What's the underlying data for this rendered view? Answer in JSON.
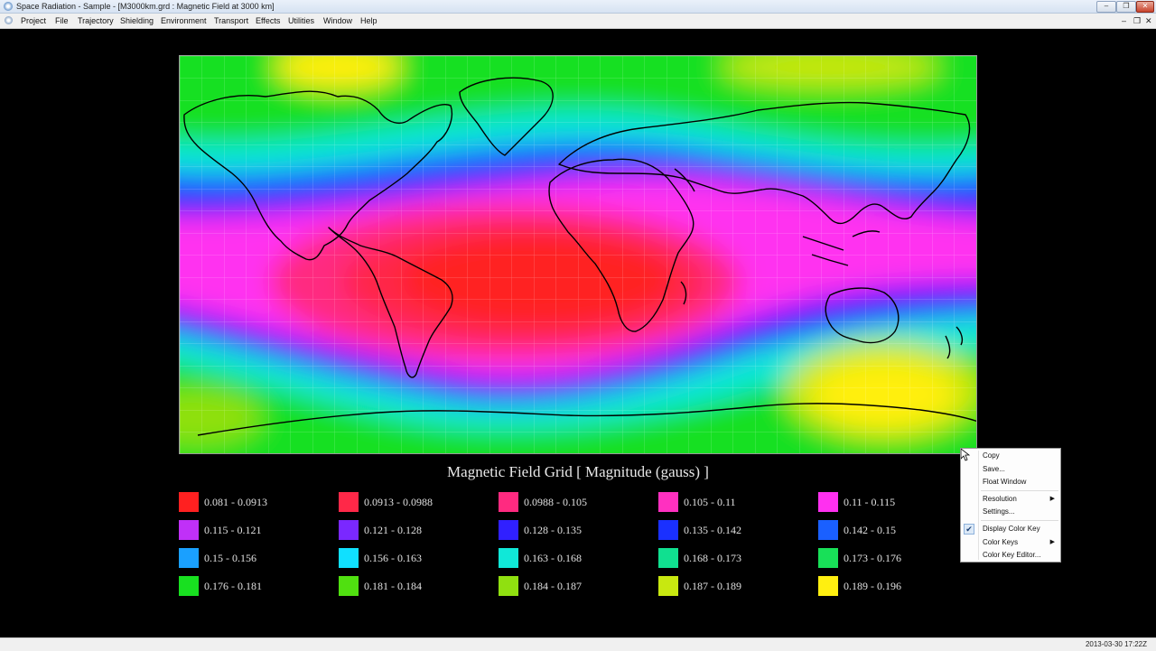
{
  "window": {
    "title": "Space Radiation - Sample - [M3000km.grd : Magnetic Field at 3000 km]",
    "controls": [
      "–",
      "❐",
      "✕"
    ],
    "mdi_controls": [
      "–",
      "❐",
      "✕"
    ]
  },
  "menu": [
    "Project",
    "File",
    "Trajectory",
    "Shielding",
    "Environment",
    "Transport",
    "Effects",
    "Utilities",
    "Window",
    "Help"
  ],
  "map": {
    "title": "Magnetic Field Grid  [ Magnitude (gauss) ]",
    "legend": [
      {
        "label": "0.081 - 0.0913",
        "color": "#ff2020"
      },
      {
        "label": "0.0913 - 0.0988",
        "color": "#ff2848"
      },
      {
        "label": "0.0988 - 0.105",
        "color": "#ff2a80"
      },
      {
        "label": "0.105 - 0.11",
        "color": "#ff30c0"
      },
      {
        "label": "0.11 - 0.115",
        "color": "#ff30f0"
      },
      {
        "label": "0.115 - 0.121",
        "color": "#c030f8"
      },
      {
        "label": "0.121 - 0.128",
        "color": "#7a28ff"
      },
      {
        "label": "0.128 - 0.135",
        "color": "#3020ff"
      },
      {
        "label": "0.135 - 0.142",
        "color": "#1a30ff"
      },
      {
        "label": "0.142 - 0.15",
        "color": "#1a60ff"
      },
      {
        "label": "0.15 - 0.156",
        "color": "#1aa0ff"
      },
      {
        "label": "0.156 - 0.163",
        "color": "#10e0ff"
      },
      {
        "label": "0.163 - 0.168",
        "color": "#10e8d8"
      },
      {
        "label": "0.168 - 0.173",
        "color": "#10e090"
      },
      {
        "label": "0.173 - 0.176",
        "color": "#18e058"
      },
      {
        "label": "0.176 - 0.181",
        "color": "#18e020"
      },
      {
        "label": "0.181 - 0.184",
        "color": "#50e010"
      },
      {
        "label": "0.184 - 0.187",
        "color": "#90e010"
      },
      {
        "label": "0.187 - 0.189",
        "color": "#c8e810"
      },
      {
        "label": "0.189 - 0.196",
        "color": "#ffef10"
      }
    ]
  },
  "context_menu": {
    "items": [
      {
        "label": "Copy"
      },
      {
        "label": "Save..."
      },
      {
        "label": "Float Window"
      },
      {
        "label": "Resolution",
        "submenu": true
      },
      {
        "label": "Settings..."
      },
      {
        "label": "Display Color Key",
        "checked": true
      },
      {
        "label": "Color Keys",
        "submenu": true
      },
      {
        "label": "Color Key Editor..."
      }
    ],
    "submenu_arrow": "▶",
    "check_mark": "✔"
  },
  "status": {
    "timestamp": "2013-03-30 17:22Z"
  }
}
